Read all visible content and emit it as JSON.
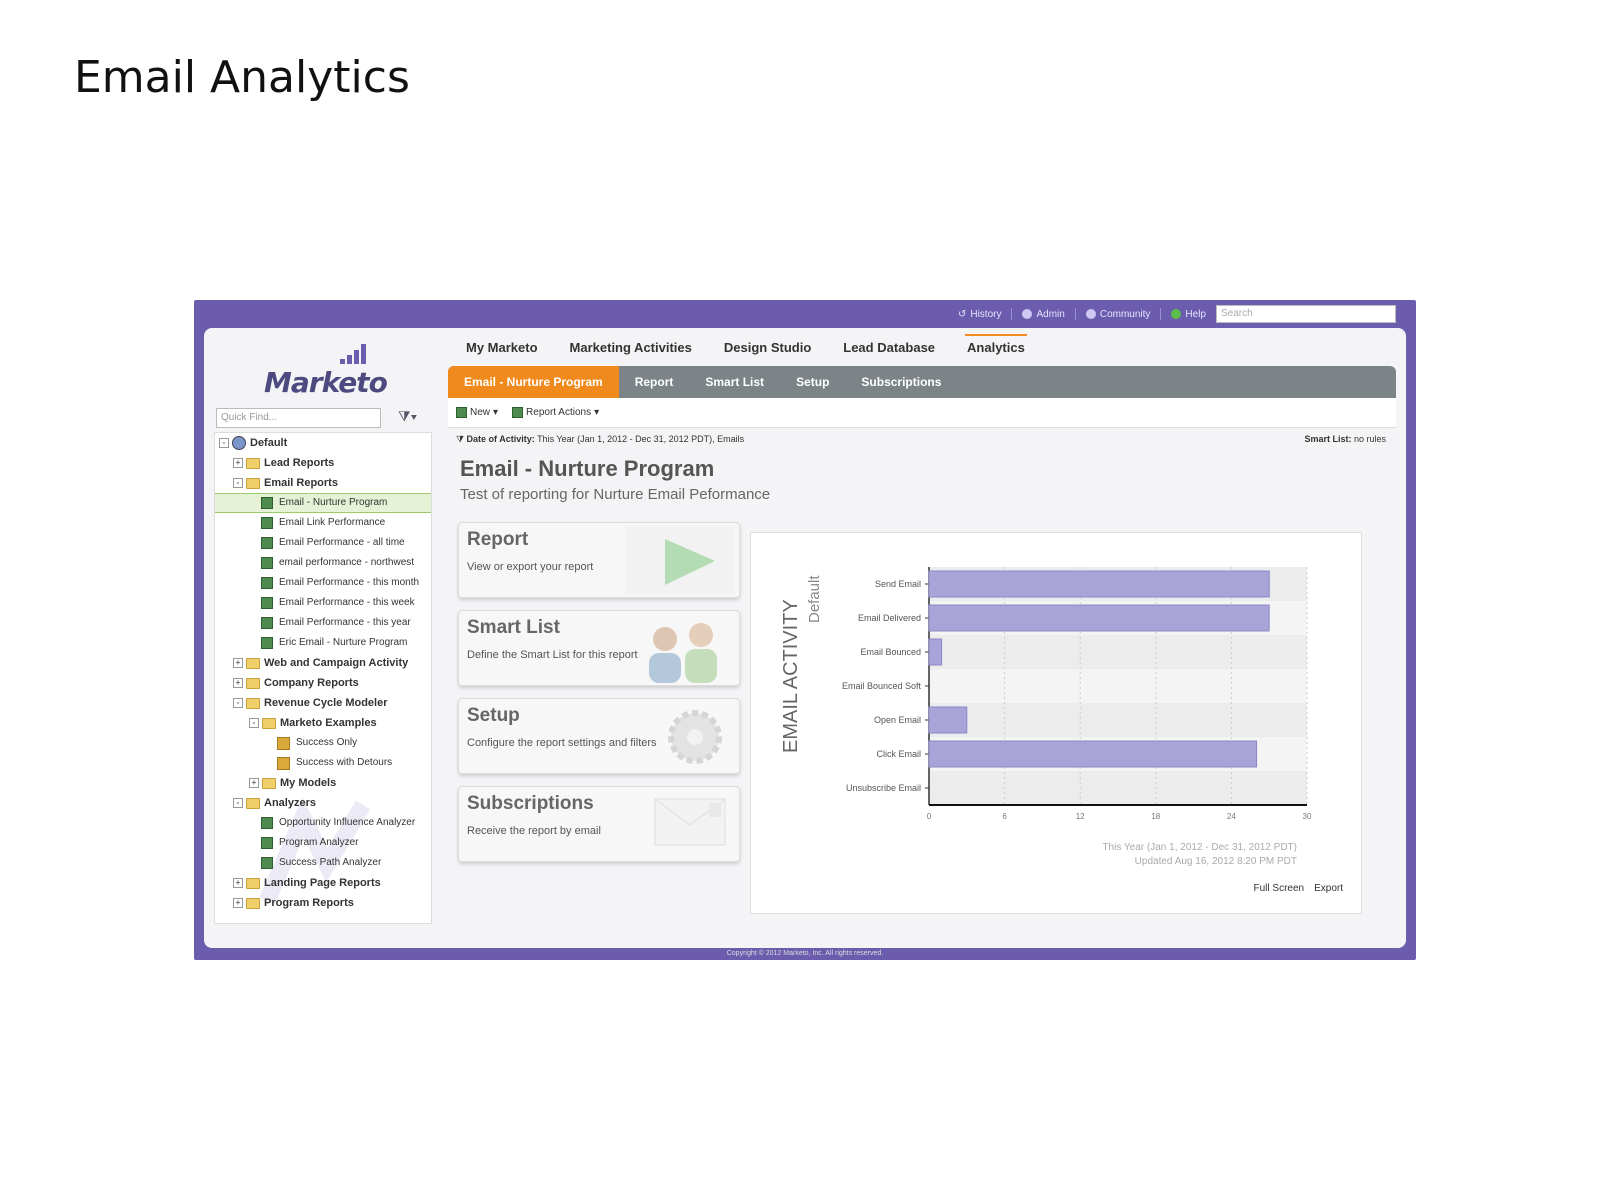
{
  "slide": {
    "title": "Email Analytics"
  },
  "utility": {
    "history": "History",
    "admin": "Admin",
    "community": "Community",
    "help": "Help",
    "search_placeholder": "Search"
  },
  "logo": {
    "text": "Marketo"
  },
  "sidebar": {
    "quickfind_placeholder": "Quick Find...",
    "tree": [
      {
        "label": "Default",
        "type": "root",
        "toggle": "-"
      },
      {
        "label": "Lead Reports",
        "type": "folder",
        "toggle": "+"
      },
      {
        "label": "Email Reports",
        "type": "folder",
        "toggle": "-"
      },
      {
        "label": "Email - Nurture Program",
        "type": "report",
        "selected": true
      },
      {
        "label": "Email Link Performance",
        "type": "report"
      },
      {
        "label": "Email Performance - all time",
        "type": "report"
      },
      {
        "label": "email performance - northwest",
        "type": "report"
      },
      {
        "label": "Email Performance - this month",
        "type": "report"
      },
      {
        "label": "Email Performance - this week",
        "type": "report"
      },
      {
        "label": "Email Performance - this year",
        "type": "report"
      },
      {
        "label": "Eric Email - Nurture Program",
        "type": "report"
      },
      {
        "label": "Web and Campaign Activity",
        "type": "folder",
        "toggle": "+"
      },
      {
        "label": "Company Reports",
        "type": "folder",
        "toggle": "+"
      },
      {
        "label": "Revenue Cycle Modeler",
        "type": "folder",
        "toggle": "-"
      },
      {
        "label": "Marketo Examples",
        "type": "subfolder",
        "toggle": "-"
      },
      {
        "label": "Success Only",
        "type": "model"
      },
      {
        "label": "Success with Detours",
        "type": "model"
      },
      {
        "label": "My Models",
        "type": "subfolder",
        "toggle": "+"
      },
      {
        "label": "Analyzers",
        "type": "folder",
        "toggle": "-"
      },
      {
        "label": "Opportunity Influence Analyzer",
        "type": "report"
      },
      {
        "label": "Program Analyzer",
        "type": "report"
      },
      {
        "label": "Success Path Analyzer",
        "type": "report"
      },
      {
        "label": "Landing Page Reports",
        "type": "folder",
        "toggle": "+"
      },
      {
        "label": "Program Reports",
        "type": "folder",
        "toggle": "+"
      }
    ]
  },
  "nav": {
    "items": [
      "My Marketo",
      "Marketing Activities",
      "Design Studio",
      "Lead Database",
      "Analytics"
    ],
    "active": "Analytics"
  },
  "tabs": {
    "items": [
      "Email - Nurture Program",
      "Report",
      "Smart List",
      "Setup",
      "Subscriptions"
    ],
    "active": "Email - Nurture Program"
  },
  "toolbar": {
    "new_label": "New",
    "actions_label": "Report Actions"
  },
  "filter": {
    "date_label": "Date of Activity:",
    "date_value": "This Year (Jan 1, 2012 - Dec 31, 2012 PDT), Emails",
    "smartlist_label": "Smart List:",
    "smartlist_value": "no rules"
  },
  "report": {
    "title": "Email - Nurture Program",
    "subtitle": "Test of reporting for Nurture Email Peformance"
  },
  "cards": [
    {
      "title": "Report",
      "desc": "View or export your report"
    },
    {
      "title": "Smart List",
      "desc": "Define the Smart List for this report"
    },
    {
      "title": "Setup",
      "desc": "Configure the report settings and filters"
    },
    {
      "title": "Subscriptions",
      "desc": "Receive the report by email"
    }
  ],
  "chart_data": {
    "type": "bar",
    "orientation": "horizontal",
    "ylabel": "EMAIL ACTIVITY",
    "ylabel_sub": "Default",
    "categories": [
      "Send Email",
      "Email Delivered",
      "Email Bounced",
      "Email Bounced Soft",
      "Open Email",
      "Click Email",
      "Unsubscribe Email"
    ],
    "values": [
      27,
      27,
      1,
      0,
      3,
      26,
      0
    ],
    "xlim": [
      0,
      30
    ],
    "xticks": [
      0,
      6,
      12,
      18,
      24,
      30
    ],
    "bar_color": "#a9a4d8",
    "grid": true,
    "footnote_1": "This Year (Jan 1, 2012 - Dec 31, 2012 PDT)",
    "footnote_2": "Updated Aug 16, 2012 8:20 PM PDT"
  },
  "chart_links": {
    "fullscreen": "Full Screen",
    "export": "Export"
  },
  "copyright": "Copyright © 2012 Marketo, Inc. All rights reserved."
}
